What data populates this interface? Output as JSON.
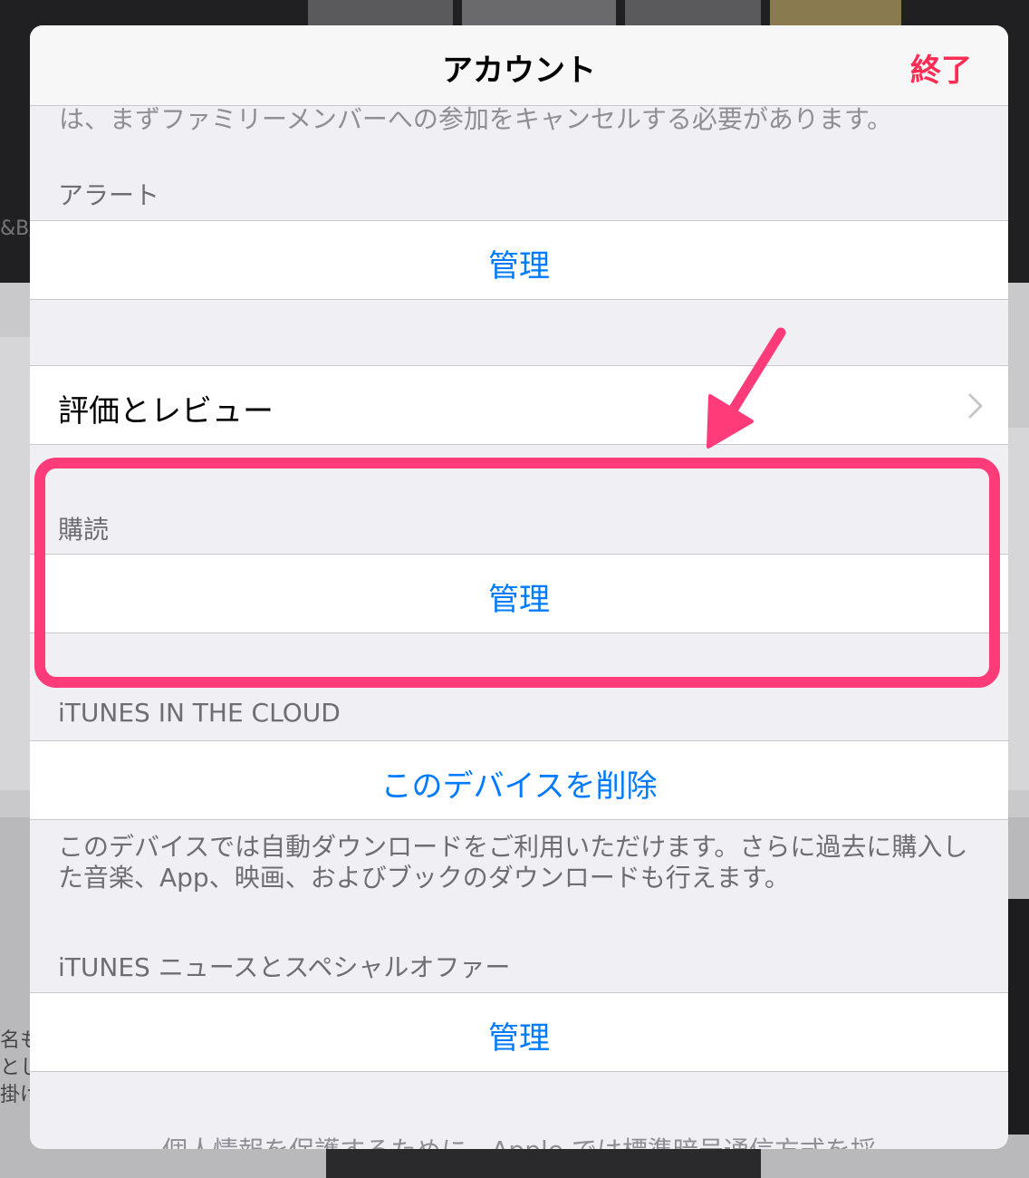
{
  "navbar": {
    "title": "アカウント",
    "done_label": "終了"
  },
  "content": {
    "clipped_text": "は、まずファミリーメンバーへの参加をキャンセルする必要があります。",
    "alerts": {
      "header": "アラート",
      "action": "管理"
    },
    "ratings": {
      "label": "評価とレビュー"
    },
    "subscriptions": {
      "header": "購読",
      "action": "管理"
    },
    "itunes_cloud": {
      "header": "iTUNES IN THE CLOUD",
      "action": "このデバイスを削除",
      "note": "このデバイスでは自動ダウンロードをご利用いただけます。さらに過去に購入した音楽、App、映画、およびブックのダウンロードも行えます。"
    },
    "itunes_news": {
      "header": "iTUNES ニュースとスペシャルオファー",
      "action": "管理"
    },
    "bottom_text": "個人情報を保護するために、Apple では標準暗号通信方式を採"
  },
  "background": {
    "fragment_1": "&B/",
    "fragment_2": "名も",
    "fragment_3": "とし",
    "fragment_4": "掛け"
  },
  "colors": {
    "accent": "#007aff",
    "done": "#ff2d55",
    "annotation": "#ff3b7a",
    "sheet_bg": "#efeff4"
  },
  "icons": {
    "disclosure": "chevron-right-icon",
    "annotation_arrow": "arrow-icon"
  }
}
